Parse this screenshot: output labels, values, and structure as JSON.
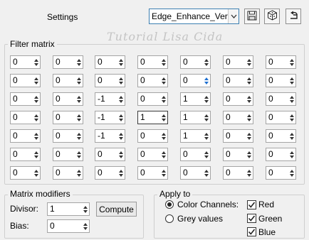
{
  "header": {
    "settings_label": "Settings",
    "preset_value": "Edge_Enhance_Vert...",
    "icons": [
      "save-icon",
      "box-icon",
      "reset-icon"
    ]
  },
  "watermark": "Tutorial Lisa Cida",
  "filter_matrix": {
    "title": "Filter matrix",
    "rows": [
      [
        "0",
        "0",
        "0",
        "0",
        "0",
        "0",
        "0"
      ],
      [
        "0",
        "0",
        "0",
        "0",
        "0",
        "0",
        "0"
      ],
      [
        "0",
        "0",
        "-1",
        "0",
        "1",
        "0",
        "0"
      ],
      [
        "0",
        "0",
        "-1",
        "1",
        "1",
        "0",
        "0"
      ],
      [
        "0",
        "0",
        "-1",
        "0",
        "1",
        "0",
        "0"
      ],
      [
        "0",
        "0",
        "0",
        "0",
        "0",
        "0",
        "0"
      ],
      [
        "0",
        "0",
        "0",
        "0",
        "0",
        "0",
        "0"
      ]
    ]
  },
  "matrix_modifiers": {
    "title": "Matrix modifiers",
    "divisor_label": "Divisor:",
    "divisor_value": "1",
    "bias_label": "Bias:",
    "bias_value": "0",
    "compute_label": "Compute"
  },
  "apply_to": {
    "title": "Apply to",
    "color_channels_label": "Color Channels:",
    "grey_values_label": "Grey values",
    "selected": "Color Channels:",
    "channels": [
      {
        "label": "Red",
        "checked": true
      },
      {
        "label": "Green",
        "checked": true
      },
      {
        "label": "Blue",
        "checked": true
      }
    ]
  }
}
